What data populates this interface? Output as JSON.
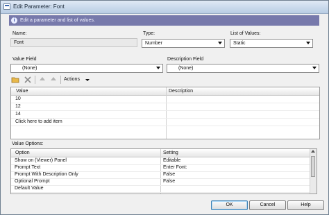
{
  "window": {
    "title": "Edit Parameter: Font"
  },
  "banner": {
    "text": "Edit a parameter and list of values."
  },
  "name": {
    "label": "Name:",
    "value": "Font"
  },
  "type": {
    "label": "Type:",
    "value": "Number"
  },
  "list_of_values": {
    "label": "List of Values:",
    "value": "Static"
  },
  "value_field": {
    "label": "Value Field",
    "value": "(None)"
  },
  "description_field": {
    "label": "Description Field",
    "value": "(None)"
  },
  "toolbar": {
    "actions_label": "Actions"
  },
  "values_table": {
    "headers": [
      "Value",
      "Description"
    ],
    "rows": [
      {
        "value": "10",
        "description": ""
      },
      {
        "value": "12",
        "description": ""
      },
      {
        "value": "14",
        "description": ""
      },
      {
        "value": "Click here to add item",
        "description": ""
      }
    ]
  },
  "value_options": {
    "label": "Value Options:",
    "headers": [
      "Option",
      "Setting"
    ],
    "rows": [
      {
        "option": "Show on (Viewer) Panel",
        "setting": "Editable"
      },
      {
        "option": "Prompt Text",
        "setting": "Enter Font:"
      },
      {
        "option": "Prompt With Description Only",
        "setting": "False"
      },
      {
        "option": "Optional Prompt",
        "setting": "False"
      },
      {
        "option": "Default Value",
        "setting": ""
      }
    ]
  },
  "buttons": {
    "ok": "OK",
    "cancel": "Cancel",
    "help": "Help"
  }
}
